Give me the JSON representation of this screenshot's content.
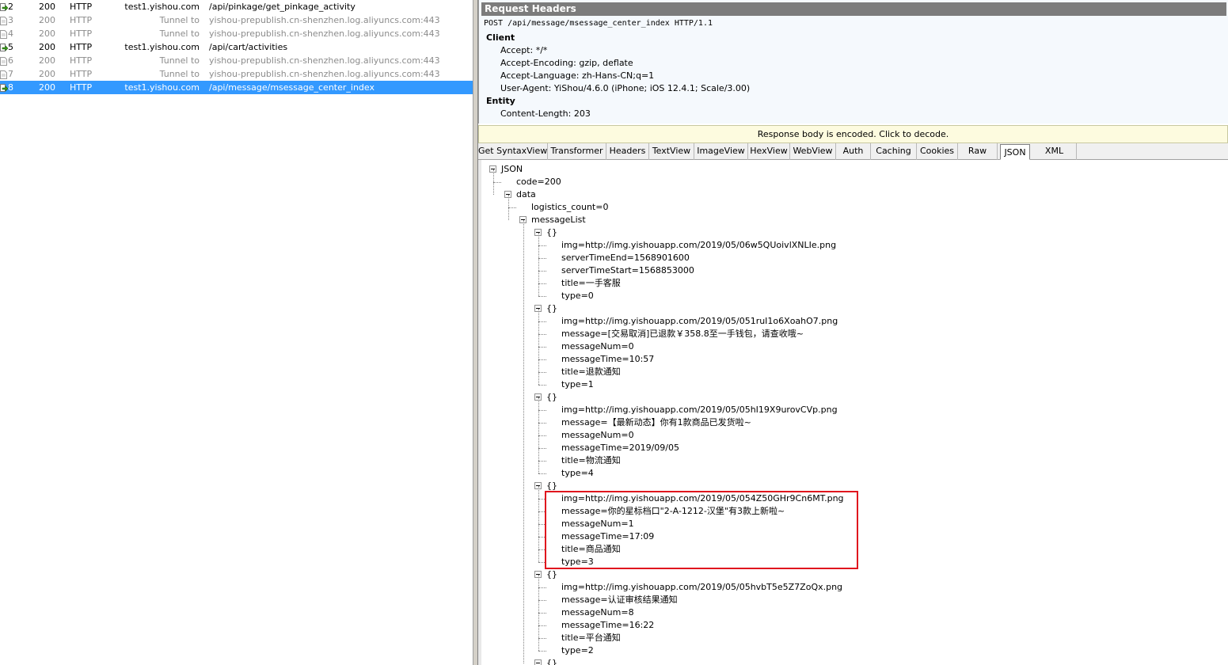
{
  "sessions": [
    {
      "num": "2",
      "result": "200",
      "protocol": "HTTP",
      "host": "test1.yishou.com",
      "url": "/api/pinkage/get_pinkage_activity",
      "style": "normal",
      "icon": "arrow-icon"
    },
    {
      "num": "3",
      "result": "200",
      "protocol": "HTTP",
      "host": "Tunnel to",
      "url": "yishou-prepublish.cn-shenzhen.log.aliyuncs.com:443",
      "style": "dim",
      "icon": "page-icon"
    },
    {
      "num": "4",
      "result": "200",
      "protocol": "HTTP",
      "host": "Tunnel to",
      "url": "yishou-prepublish.cn-shenzhen.log.aliyuncs.com:443",
      "style": "dim",
      "icon": "page-icon"
    },
    {
      "num": "5",
      "result": "200",
      "protocol": "HTTP",
      "host": "test1.yishou.com",
      "url": "/api/cart/activities",
      "style": "normal",
      "icon": "arrow-icon"
    },
    {
      "num": "6",
      "result": "200",
      "protocol": "HTTP",
      "host": "Tunnel to",
      "url": "yishou-prepublish.cn-shenzhen.log.aliyuncs.com:443",
      "style": "dim",
      "icon": "page-icon"
    },
    {
      "num": "7",
      "result": "200",
      "protocol": "HTTP",
      "host": "Tunnel to",
      "url": "yishou-prepublish.cn-shenzhen.log.aliyuncs.com:443",
      "style": "dim",
      "icon": "page-icon"
    },
    {
      "num": "8",
      "result": "200",
      "protocol": "HTTP",
      "host": "test1.yishou.com",
      "url": "/api/message/msessage_center_index",
      "style": "selected",
      "icon": "arrow-icon"
    }
  ],
  "request": {
    "title": "Request Headers",
    "request_line": "POST /api/message/msessage_center_index HTTP/1.1",
    "client_label": "Client",
    "client_headers": [
      "Accept: */*",
      "Accept-Encoding: gzip, deflate",
      "Accept-Language: zh-Hans-CN;q=1",
      "User-Agent: YiShou/4.6.0 (iPhone; iOS 12.4.1; Scale/3.00)"
    ],
    "entity_label": "Entity",
    "entity_headers": [
      "Content-Length: 203"
    ]
  },
  "decode_bar": "Response body is encoded. Click to decode.",
  "tabs": [
    "Get SyntaxView",
    "Transformer",
    "Headers",
    "TextView",
    "ImageView",
    "HexView",
    "WebView",
    "Auth",
    "Caching",
    "Cookies",
    "Raw",
    "JSON",
    "XML"
  ],
  "active_tab": "JSON",
  "tree": {
    "root": "JSON",
    "code": "code=200",
    "data": "data",
    "logistics": "logistics_count=0",
    "message_list": "messageList",
    "object_label": "{}",
    "items": [
      [
        "img=http://img.yishouapp.com/2019/05/06w5QUoivlXNLIe.png",
        "serverTimeEnd=1568901600",
        "serverTimeStart=1568853000",
        "title=一手客服",
        "type=0"
      ],
      [
        "img=http://img.yishouapp.com/2019/05/051ruI1o6XoahO7.png",
        "message=[交易取消]已退款￥358.8至一手钱包，请查收哦~",
        "messageNum=0",
        "messageTime=10:57",
        "title=退款通知",
        "type=1"
      ],
      [
        "img=http://img.yishouapp.com/2019/05/05hI19X9urovCVp.png",
        "message=【最新动态】你有1款商品已发货啦~",
        "messageNum=0",
        "messageTime=2019/09/05",
        "title=物流通知",
        "type=4"
      ],
      [
        "img=http://img.yishouapp.com/2019/05/054Z50GHr9Cn6MT.png",
        "message=你的星标档口\"2-A-1212-汉堡\"有3款上新啦~",
        "messageNum=1",
        "messageTime=17:09",
        "title=商品通知",
        "type=3"
      ],
      [
        "img=http://img.yishouapp.com/2019/05/05hvbT5e5Z7ZoQx.png",
        "message=认证审核结果通知",
        "messageNum=8",
        "messageTime=16:22",
        "title=平台通知",
        "type=2"
      ]
    ]
  },
  "colors": {
    "selection": "#3399ff",
    "highlight_box": "#e0161e",
    "header_bar": "#7c7c7c"
  }
}
